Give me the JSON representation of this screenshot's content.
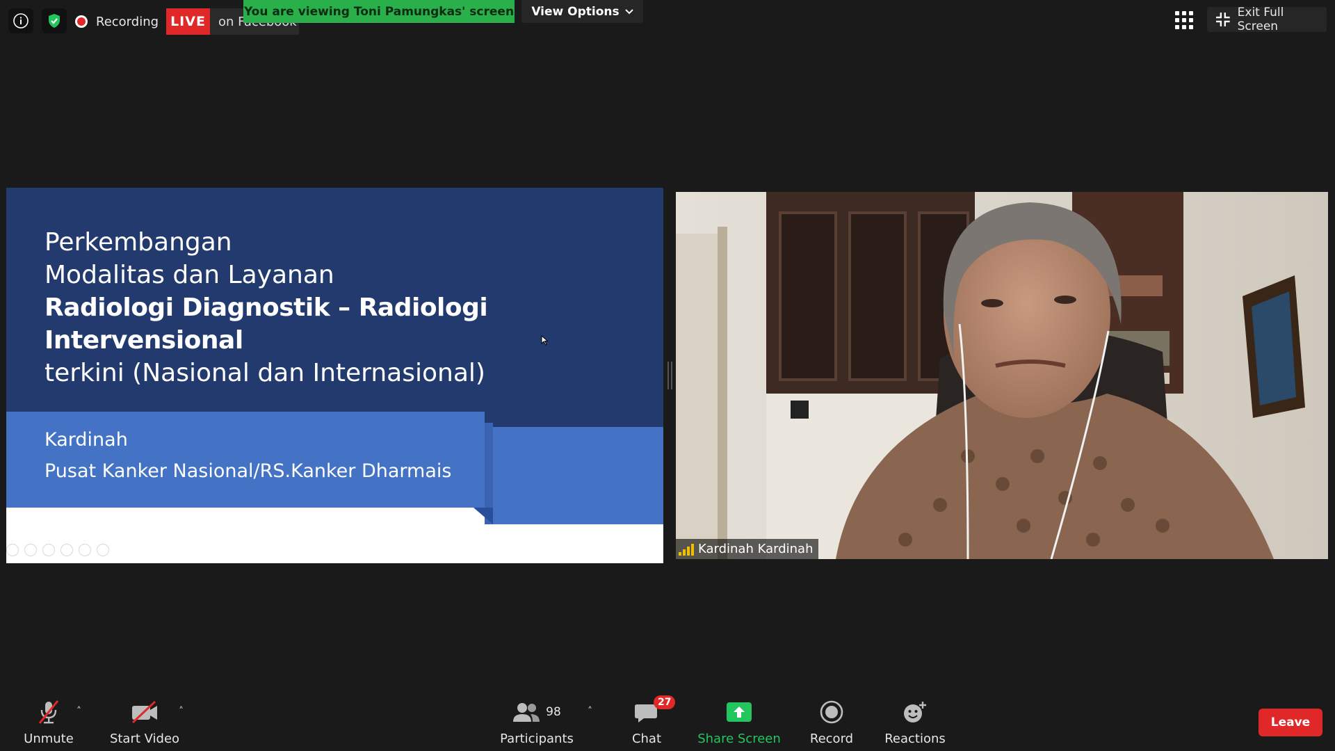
{
  "top_bar": {
    "info_icon": "info-icon",
    "security_icon": "shield-check-icon",
    "recording_label": "Recording",
    "live_label": "LIVE",
    "live_platform": "on Facebook",
    "viewing_banner": "You are viewing Toni Pamungkas' screen",
    "view_options_label": "View Options",
    "gallery_icon": "grid-icon",
    "exit_fullscreen_label": "Exit Full Screen"
  },
  "slide": {
    "title_line1": "Perkembangan",
    "title_line2": "Modalitas dan Layanan",
    "title_line3": "Radiologi Diagnostik – Radiologi",
    "title_line4": "Intervensional",
    "title_line5": "terkini (Nasional dan Internasional)",
    "author": "Kardinah",
    "affiliation": "Pusat Kanker Nasional/RS.Kanker Dharmais"
  },
  "video": {
    "participant_name": "Kardinah Kardinah"
  },
  "toolbar": {
    "unmute_label": "Unmute",
    "start_video_label": "Start Video",
    "participants_count": "98",
    "participants_label": "Participants",
    "chat_badge": "27",
    "chat_label": "Chat",
    "share_screen_label": "Share Screen",
    "record_label": "Record",
    "reactions_label": "Reactions",
    "leave_label": "Leave"
  },
  "colors": {
    "live_red": "#e02828",
    "share_green": "#22c55e",
    "banner_green": "#2ab04a",
    "slide_navy": "#223a6e",
    "slide_blue": "#4472c4"
  }
}
